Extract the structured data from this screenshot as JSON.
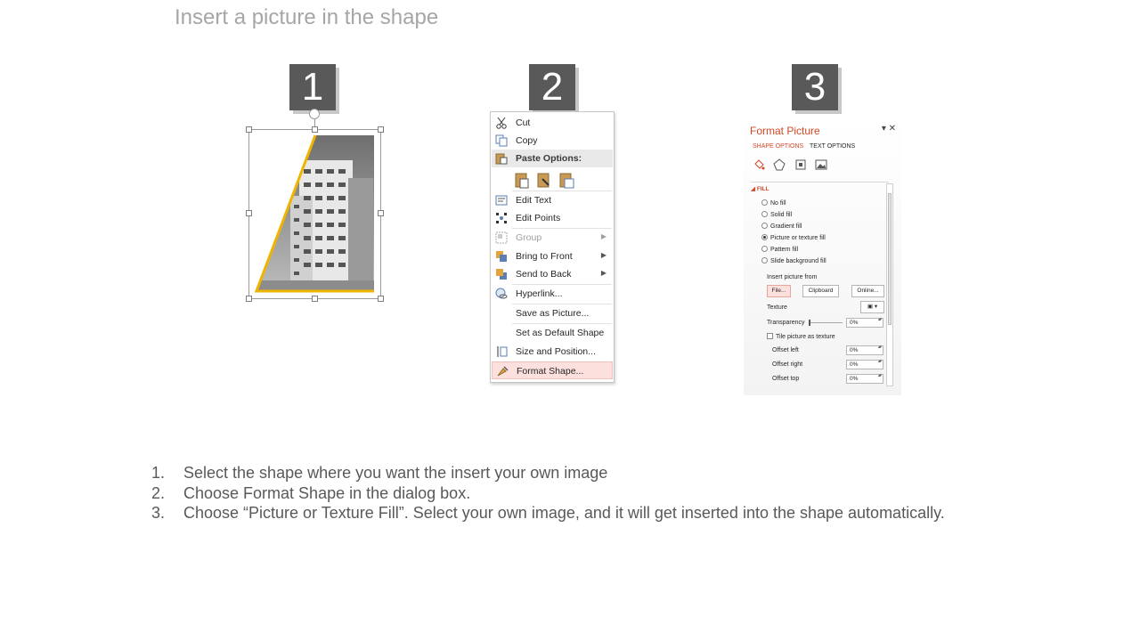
{
  "slide": {
    "title": "Insert a picture in the shape"
  },
  "steps": {
    "badge1": "1",
    "badge2": "2",
    "badge3": "3"
  },
  "context_menu": {
    "items": [
      {
        "label": "Cut",
        "icon": "scissors-icon"
      },
      {
        "label": "Copy",
        "icon": "copy-icon"
      },
      {
        "label": "Paste Options:",
        "icon": "paste-icon"
      },
      {
        "label": "Edit Text",
        "icon": "edit-text-icon"
      },
      {
        "label": "Edit Points",
        "icon": "edit-points-icon"
      },
      {
        "label": "Group",
        "icon": "group-icon"
      },
      {
        "label": "Bring to Front",
        "icon": "bring-to-front-icon"
      },
      {
        "label": "Send to Back",
        "icon": "send-to-back-icon"
      },
      {
        "label": "Hyperlink...",
        "icon": "hyperlink-icon"
      },
      {
        "label": "Save as Picture...",
        "icon": ""
      },
      {
        "label": "Set as Default Shape",
        "icon": ""
      },
      {
        "label": "Size and Position...",
        "icon": "size-position-icon"
      },
      {
        "label": "Format Shape...",
        "icon": "format-shape-icon"
      }
    ]
  },
  "format_pane": {
    "title": "Format Picture",
    "tab_shape": "SHAPE OPTIONS",
    "tab_text": "TEXT OPTIONS",
    "section": "FILL",
    "fill_options": [
      "No fill",
      "Solid fill",
      "Gradient fill",
      "Picture or texture fill",
      "Pattern fill",
      "Slide background fill"
    ],
    "selected_fill": "Picture or texture fill",
    "insert_from": "Insert picture from",
    "btn_file": "File...",
    "btn_clipboard": "Clipboard",
    "btn_online": "Online...",
    "texture": "Texture",
    "transparency": "Transparency",
    "transparency_value": "0%",
    "tile": "Tile picture as texture",
    "offset_left": "Offset left",
    "offset_left_value": "0%",
    "offset_right": "Offset right",
    "offset_right_value": "0%",
    "offset_top": "Offset top",
    "offset_top_value": "0%"
  },
  "instructions": [
    {
      "num": "1.",
      "text": "Select the shape where you want the insert your own image"
    },
    {
      "num": "2.",
      "text": "Choose Format Shape in the dialog box."
    },
    {
      "num": "3.",
      "text": "Choose “Picture or Texture Fill”. Select your own image, and it will get inserted into the shape automatically."
    }
  ],
  "colors": {
    "badge": "#595959",
    "accent": "#d24726",
    "shape_outline": "#f0b400",
    "highlight": "#fbe0dd"
  }
}
